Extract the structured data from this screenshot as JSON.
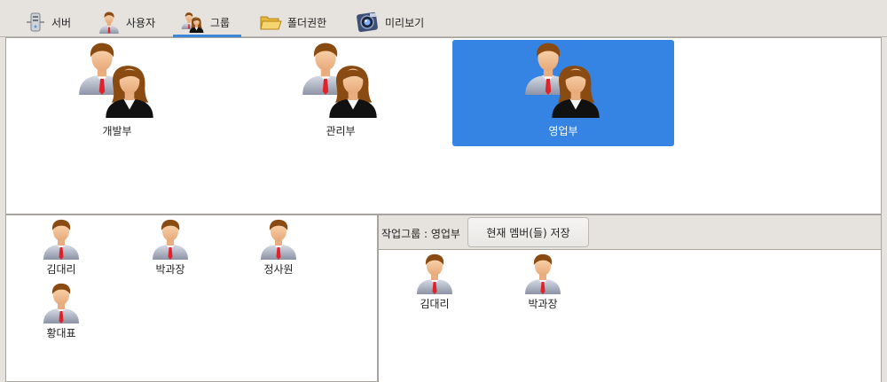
{
  "tabs": [
    {
      "label": "서버",
      "icon": "server-icon"
    },
    {
      "label": "사용자",
      "icon": "user-icon"
    },
    {
      "label": "그룹",
      "icon": "group-icon",
      "active": true
    },
    {
      "label": "폴더권한",
      "icon": "folder-icon"
    },
    {
      "label": "미리보기",
      "icon": "preview-icon"
    }
  ],
  "groups": [
    {
      "label": "개발부",
      "selected": false
    },
    {
      "label": "관리부",
      "selected": false
    },
    {
      "label": "영업부",
      "selected": true
    }
  ],
  "all_users": [
    {
      "label": "김대리"
    },
    {
      "label": "박과장"
    },
    {
      "label": "정사원"
    },
    {
      "label": "황대표"
    }
  ],
  "working_group": {
    "label": "작업그룹 : 영업부",
    "save_button": "현재 멤버(들) 저장"
  },
  "members": [
    {
      "label": "김대리"
    },
    {
      "label": "박과장"
    }
  ],
  "colors": {
    "accent": "#3584e4",
    "tab_indicator": "#3a86d8",
    "tie": "#e0232b"
  }
}
